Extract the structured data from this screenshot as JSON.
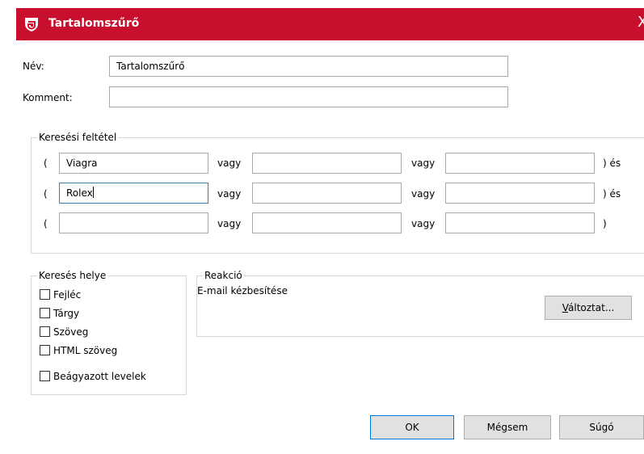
{
  "window": {
    "title": "Tartalomszűrő",
    "close_glyph": "X"
  },
  "colors": {
    "titlebar": "#c8102e",
    "focus_border": "#3c7fb1",
    "button_border_default": "#0078d7"
  },
  "icons": {
    "logo": "g-data-shield-icon",
    "close": "close-icon"
  },
  "fields": {
    "name": {
      "label": "Név:",
      "value": "Tartalomszűrő"
    },
    "comment": {
      "label": "Komment:",
      "value": ""
    }
  },
  "search_condition": {
    "title": "Keresési feltétel",
    "rows": [
      {
        "open": "(",
        "terms": [
          "Viagra",
          "",
          ""
        ],
        "sep1": "vagy",
        "sep2": "vagy",
        "close": ") és"
      },
      {
        "open": "(",
        "terms": [
          "Rolex",
          "",
          ""
        ],
        "sep1": "vagy",
        "sep2": "vagy",
        "close": ") és"
      },
      {
        "open": "(",
        "terms": [
          "",
          "",
          ""
        ],
        "sep1": "vagy",
        "sep2": "vagy",
        "close": ")"
      }
    ]
  },
  "search_location": {
    "title": "Keresés helye",
    "options": [
      {
        "label": "Fejléc",
        "checked": false
      },
      {
        "label": "Tárgy",
        "checked": false
      },
      {
        "label": "Szöveg",
        "checked": false
      },
      {
        "label": "HTML szöveg",
        "checked": false
      },
      {
        "label": "Beágyazott levelek",
        "checked": false
      }
    ]
  },
  "reaction": {
    "title": "Reakció",
    "value": "E-mail kézbesítése",
    "change_button": {
      "underlined": "V",
      "rest": "áltoztat..."
    }
  },
  "buttons": {
    "ok": "OK",
    "cancel": "Mégsem",
    "help": "Súgó"
  }
}
